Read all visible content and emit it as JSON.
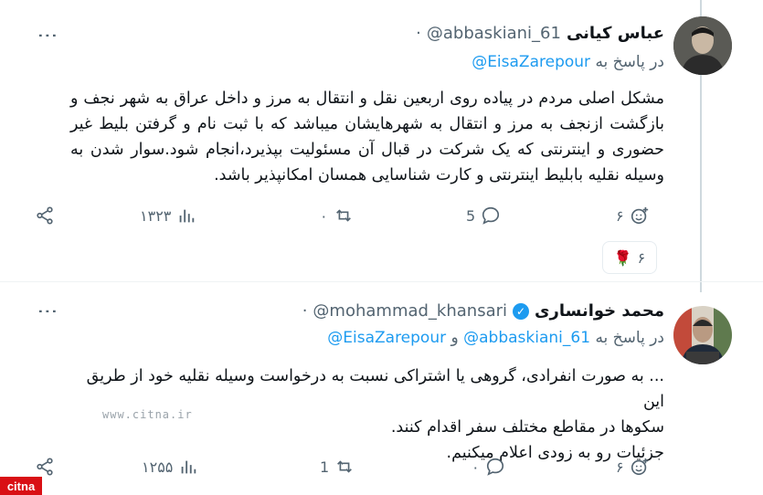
{
  "tweets": [
    {
      "name": "عباس کیانی",
      "handle": "@abbaskiani_61",
      "separator": "·",
      "reply_prefix": "در پاسخ به",
      "reply_to": "@EisaZarepour",
      "reply_and": "",
      "reply_to2": "",
      "text": "مشکل اصلی مردم در پیاده روی اربعین نقل و انتقال به مرز و داخل عراق به شهر نجف و بازگشت ازنجف به مرز و انتقال به شهرهایشان میباشد که با ثبت نام و گرفتن بلیط غیر حضوری و اینترنتی که یک شرکت در قبال آن مسئولیت بپذیرد،انجام شود.سوار شدن به وسیله نقلیه بابلیط اینترنتی و کارت شناسایی همسان امکانپذیر باشد.",
      "actions": {
        "reactions": "۶",
        "replies": "5",
        "retweets": "۰",
        "views": "۱۳۲۳"
      }
    },
    {
      "name": "محمد خوانساری",
      "handle": "@mohammad_khansari",
      "separator": "·",
      "reply_prefix": "در پاسخ به",
      "reply_to": "@abbaskiani_61",
      "reply_and": "و",
      "reply_to2": "@EisaZarepour",
      "text_lines": [
        "... به صورت انفرادی، گروهی یا  اشتراکی نسبت به درخواست وسیله نقلیه خود از طریق این",
        "سکوها در مقاطع مختلف سفر اقدام کنند.",
        "جزئیات رو به زودی اعلام میکنیم."
      ],
      "actions": {
        "reactions": "۶",
        "replies": "۰",
        "retweets": "1",
        "views": "۱۲۵۵"
      }
    }
  ],
  "reaction_chip": {
    "emoji": "🌹",
    "count": "۶"
  },
  "watermark": "www.citna.ir",
  "logo": "citna",
  "colors": {
    "accent": "#1d9bf0",
    "muted": "#536471",
    "logo": "#d90f14"
  }
}
